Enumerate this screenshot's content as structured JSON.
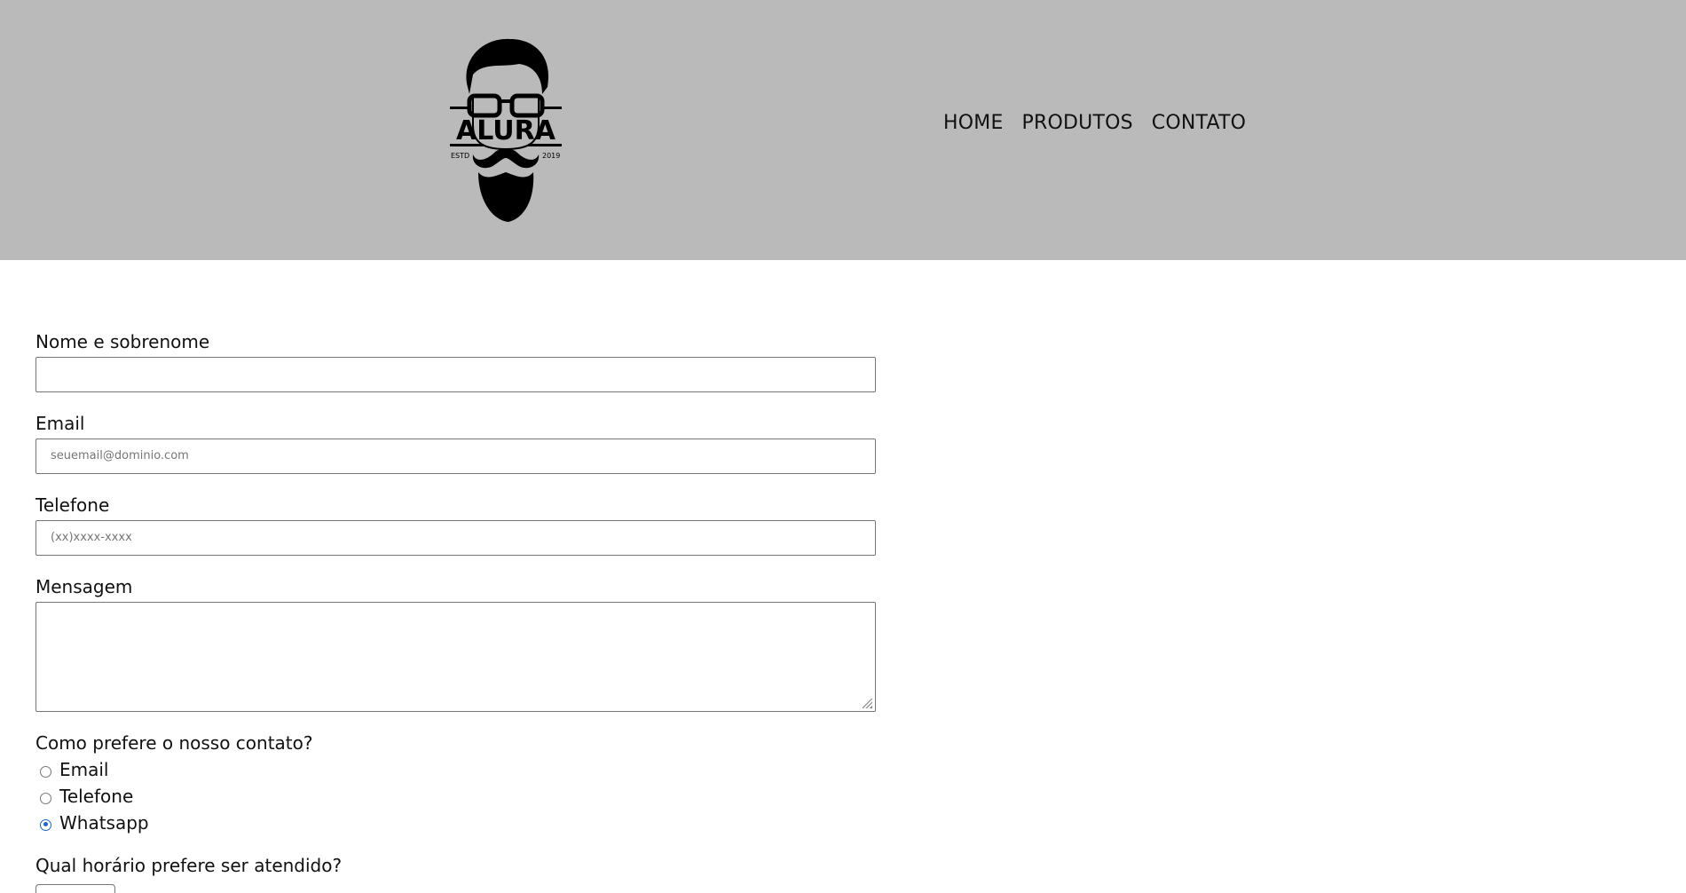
{
  "header": {
    "logo": {
      "text": "ALURA",
      "left": "ESTD",
      "right": "2019"
    },
    "nav": [
      {
        "label": "HOME"
      },
      {
        "label": "PRODUTOS"
      },
      {
        "label": "CONTATO"
      }
    ]
  },
  "form": {
    "name": {
      "label": "Nome e sobrenome",
      "value": "",
      "placeholder": ""
    },
    "email": {
      "label": "Email",
      "placeholder": "seuemail@dominio.com"
    },
    "phone": {
      "label": "Telefone",
      "placeholder": "(xx)xxxx-xxxx"
    },
    "message": {
      "label": "Mensagem",
      "value": ""
    },
    "contact_pref": {
      "label": "Como prefere o nosso contato?",
      "options": [
        {
          "label": "Email",
          "checked": false
        },
        {
          "label": "Telefone",
          "checked": false
        },
        {
          "label": "Whatsapp",
          "checked": true
        }
      ]
    },
    "time_pref": {
      "label": "Qual horário prefere ser atendido?"
    }
  },
  "colors": {
    "header_bg": "#bababa",
    "radio_accent": "#1a64d6"
  }
}
